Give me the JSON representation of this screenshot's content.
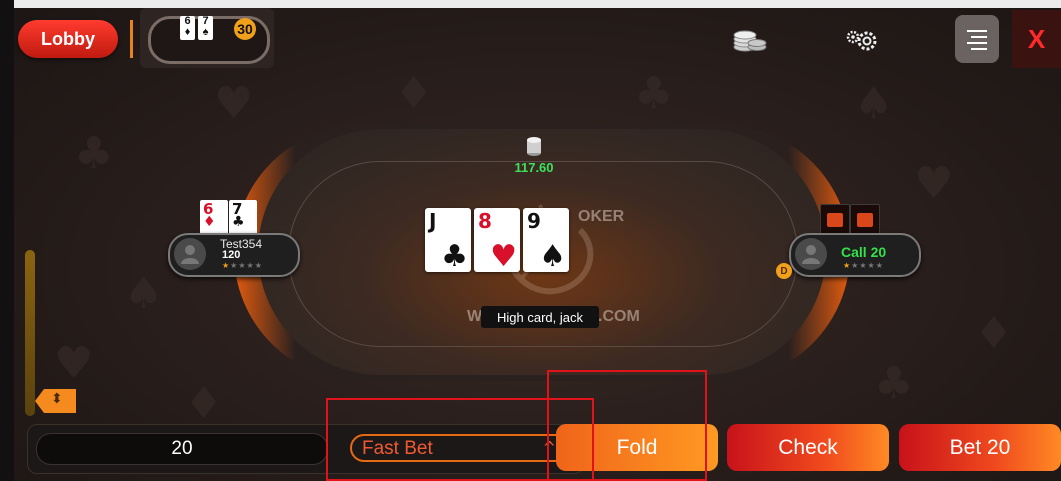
{
  "header": {
    "lobby_label": "Lobby",
    "mini_table": {
      "card1_rank": "6",
      "card1_suit": "♦",
      "card2_rank": "7",
      "card2_suit": "♠",
      "badge": "30"
    },
    "close_label": "X"
  },
  "table": {
    "pot_amount": "117.60",
    "watermark_left": "W",
    "watermark_right": ".COM",
    "watermark_top": "OKER",
    "community_cards": [
      {
        "rank": "J",
        "suit": "♣",
        "color": "black"
      },
      {
        "rank": "8",
        "suit": "♥",
        "color": "red"
      },
      {
        "rank": "9",
        "suit": "♠",
        "color": "black"
      }
    ],
    "hand_description": "High card, jack"
  },
  "seats": {
    "hero": {
      "name": "Test354",
      "stack": "120",
      "rating": "★",
      "rating_empty": "★★★★",
      "cards": [
        {
          "rank": "6",
          "suit": "♦",
          "color": "red"
        },
        {
          "rank": "7",
          "suit": "♣",
          "color": "black"
        }
      ]
    },
    "opponent": {
      "action": "Call 20",
      "rating": "★",
      "rating_empty": "★★★★",
      "dealer_label": "D"
    }
  },
  "controls": {
    "bet_amount": "20",
    "fast_bet_label": "Fast Bet",
    "fast_bet_chevron": "^",
    "fold_label": "Fold",
    "check_label": "Check",
    "bet_label": "Bet  20",
    "slider_handle_icon": "⬍"
  },
  "colors": {
    "accent_orange": "#f58a1f",
    "danger_red": "#e0121a",
    "call_green": "#35e04a"
  }
}
